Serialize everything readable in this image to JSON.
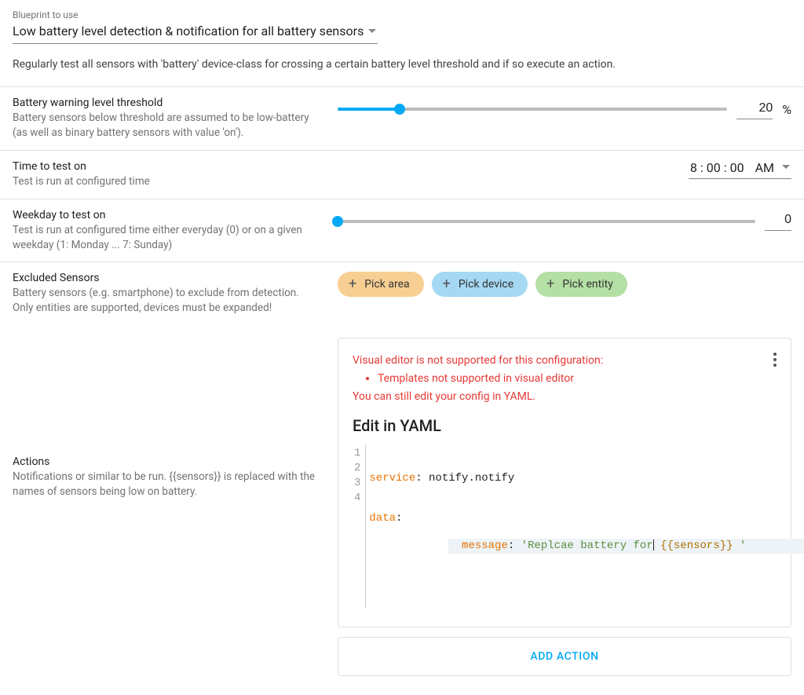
{
  "blueprint": {
    "field_label": "Blueprint to use",
    "selected": "Low battery level detection & notification for all battery sensors",
    "description": "Regularly test all sensors with 'battery' device-class for crossing a certain battery level threshold and if so execute an action."
  },
  "threshold": {
    "title": "Battery warning level threshold",
    "desc": "Battery sensors below threshold are assumed to be low-battery (as well as binary battery sensors with value 'on').",
    "value": "20",
    "unit": "%",
    "slider_percent": 16
  },
  "time": {
    "title": "Time to test on",
    "desc": "Test is run at configured time",
    "hour": "8",
    "min": "00",
    "sec": "00",
    "ampm": "AM"
  },
  "weekday": {
    "title": "Weekday to test on",
    "desc": "Test is run at configured time either everyday (0) or on a given weekday (1: Monday ... 7: Sunday)",
    "value": "0",
    "slider_percent": 0
  },
  "excluded": {
    "title": "Excluded Sensors",
    "desc": "Battery sensors (e.g. smartphone) to exclude from detection. Only entities are supported, devices must be expanded!",
    "pick_area": "Pick area",
    "pick_device": "Pick device",
    "pick_entity": "Pick entity"
  },
  "actions": {
    "title": "Actions",
    "desc": "Notifications or similar to be run. {{sensors}} is replaced with the names of sensors being low on battery.",
    "error_header": "Visual editor is not supported for this configuration:",
    "error_item": "Templates not supported in visual editor",
    "error_footer": "You can still edit your config in YAML.",
    "edit_heading": "Edit in YAML",
    "yaml": {
      "l1_key": "service",
      "l1_val": "notify.notify",
      "l2_key": "data",
      "l3_key": "message",
      "l3_str_a": "'Replcae battery for",
      "l3_var": "{{sensors}}",
      "l3_str_b": " '"
    },
    "add_action": "ADD ACTION"
  }
}
